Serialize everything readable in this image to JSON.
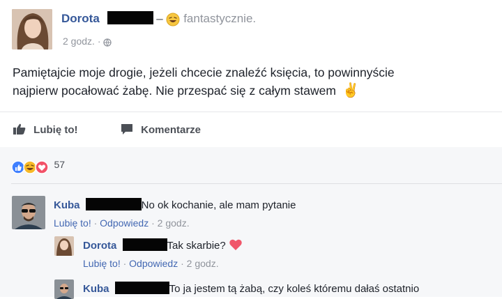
{
  "post": {
    "author": "Dorota",
    "feeling_separator": "–",
    "feeling_text": "fantastycznie.",
    "time": "2 godz.",
    "time_sep": "·",
    "text_line1": "Pamiętajcie moje drogie, jeżeli chcecie znaleźć księcia, to powinnyście",
    "text_line2": "najpierw pocałować żabę. Nie przespać się z całym stawem",
    "emoji": "✌"
  },
  "actions": {
    "like": "Lubię to!",
    "comment": "Komentarze"
  },
  "reactions": {
    "count": "57",
    "colors": {
      "like": "#4080ff",
      "haha": "#f7b928",
      "love": "#f25268"
    }
  },
  "comments": [
    {
      "author": "Kuba",
      "text": "No ok kochanie, ale mam pytanie",
      "like": "Lubię to!",
      "sep": "·",
      "reply": "Odpowiedz",
      "time": "2 godz."
    },
    {
      "author": "Dorota",
      "text": "Tak skarbie?",
      "like": "Lubię to!",
      "sep": "·",
      "reply": "Odpowiedz",
      "time": "2 godz.",
      "emoji": "heart"
    },
    {
      "author": "Kuba",
      "text": "To ja jestem tą żabą, czy koleś któremu dałaś ostatnio"
    }
  ]
}
